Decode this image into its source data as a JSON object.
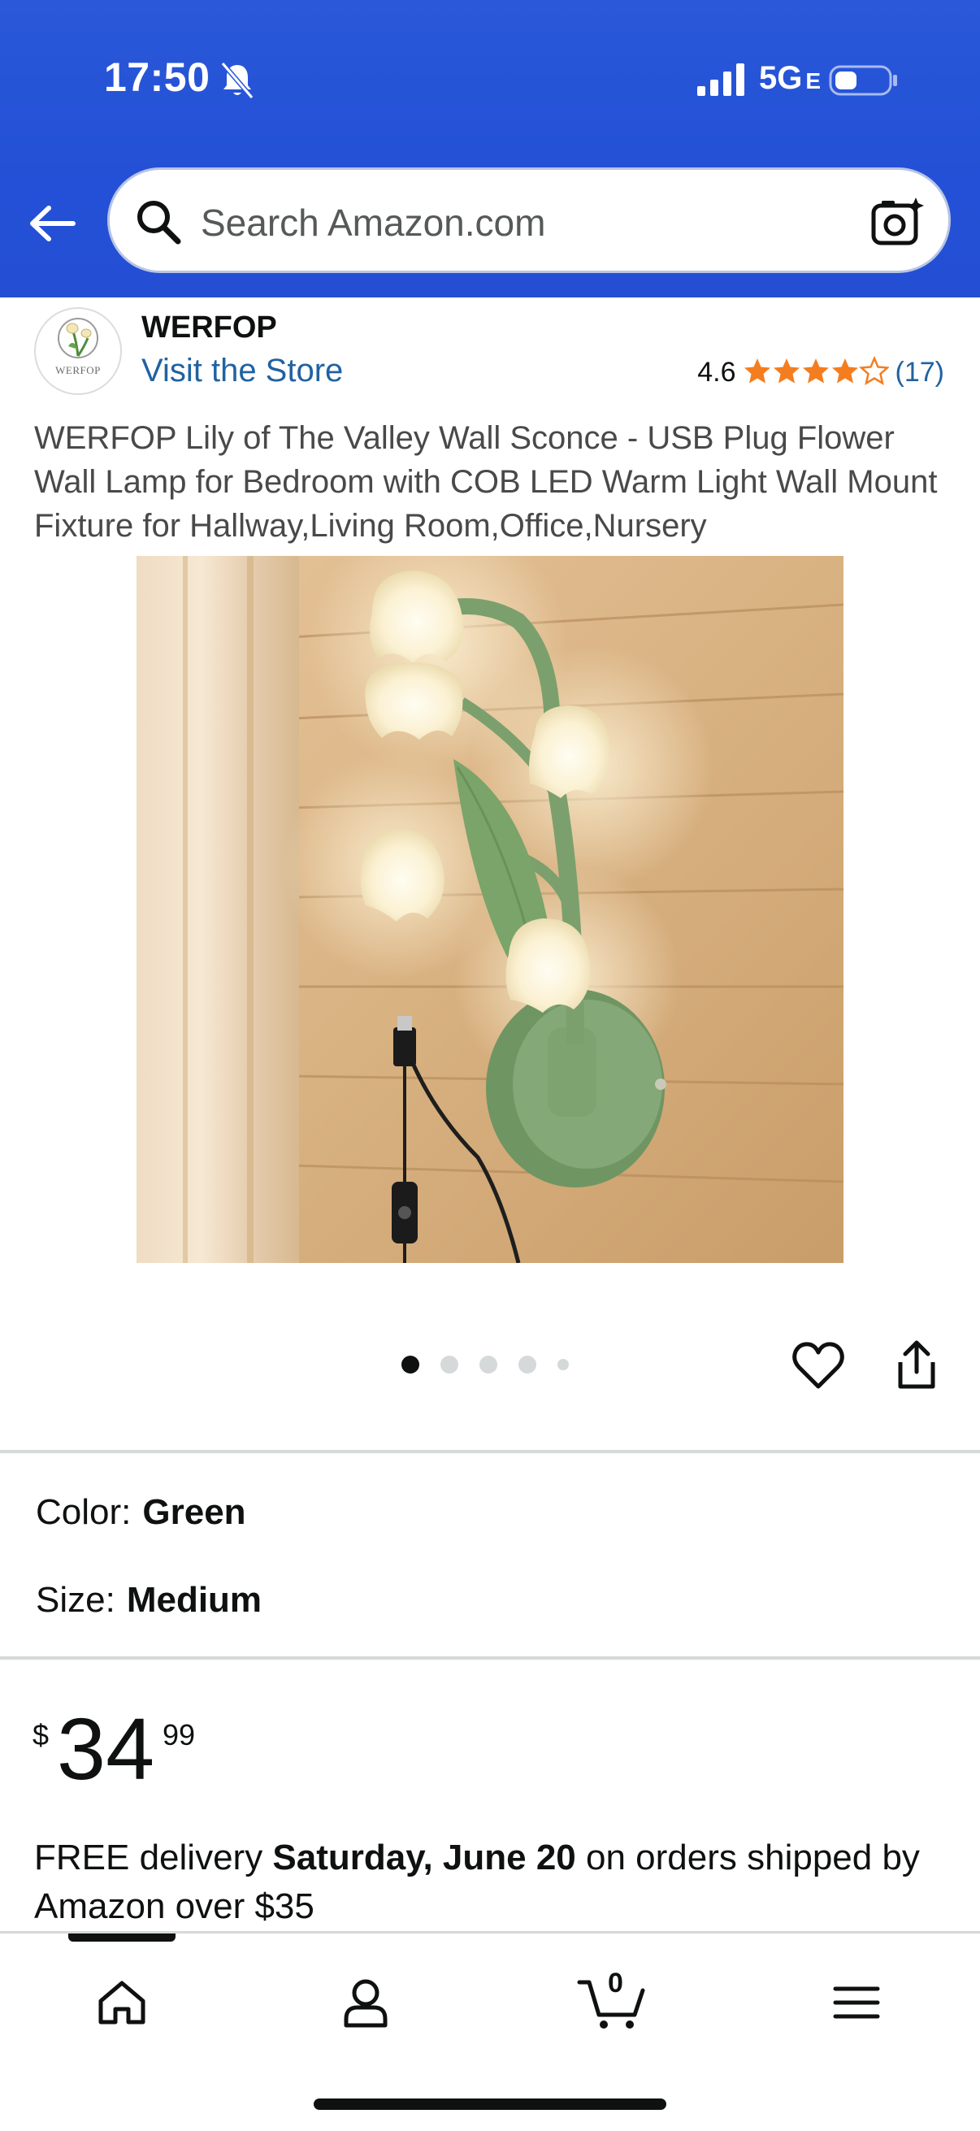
{
  "status_bar": {
    "time": "17:50",
    "network": "5G",
    "network_suffix": "E"
  },
  "header": {
    "search_placeholder": "Search Amazon.com"
  },
  "brand": {
    "logo_text": "WERFOP",
    "name": "WERFOP",
    "visit_store": "Visit the Store"
  },
  "rating": {
    "value": "4.6",
    "stars": 4.6,
    "count": "(17)"
  },
  "product": {
    "title": "WERFOP Lily of The Valley Wall Sconce - USB Plug Flower Wall Lamp for Bedroom with COB LED Warm Light Wall Mount Fixture for Hallway,Living Room,Office,Nursery"
  },
  "carousel": {
    "total_images": 5,
    "active_index": 0
  },
  "variations": {
    "color_label": "Color:",
    "color_value": "Green",
    "size_label": "Size:",
    "size_value": "Medium"
  },
  "price": {
    "currency": "$",
    "whole": "34",
    "fraction": "99"
  },
  "delivery": {
    "prefix": "FREE delivery ",
    "date": "Saturday, June 20",
    "suffix": " on orders shipped by Amazon over $35"
  },
  "bottom_nav": {
    "cart_count": "0",
    "items": [
      "home",
      "account",
      "cart",
      "menu"
    ]
  },
  "colors": {
    "header_blue": "#2350d6",
    "link_blue": "#2162a1",
    "star_orange": "#f47d20",
    "text": "#0f1111"
  }
}
